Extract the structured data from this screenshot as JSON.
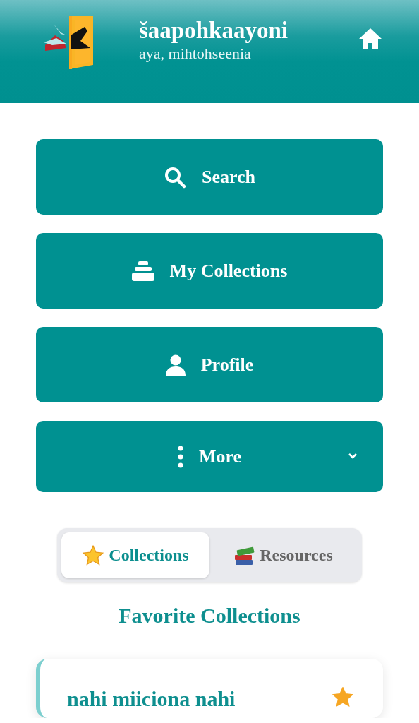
{
  "header": {
    "title": "šaapohkaayoni",
    "subtitle": "aya, mihtohseenia"
  },
  "menu": [
    {
      "kind": "search",
      "label": "Search"
    },
    {
      "kind": "collections",
      "label": "My Collections"
    },
    {
      "kind": "profile",
      "label": "Profile"
    },
    {
      "kind": "more",
      "label": "More"
    }
  ],
  "tabs": [
    {
      "kind": "star",
      "label": "Collections",
      "selected": true
    },
    {
      "kind": "books",
      "label": "Resources",
      "selected": false
    }
  ],
  "section_title": "Favorite Collections",
  "collections": [
    {
      "title": "nahi miiciona nahi",
      "favorite": true
    }
  ]
}
